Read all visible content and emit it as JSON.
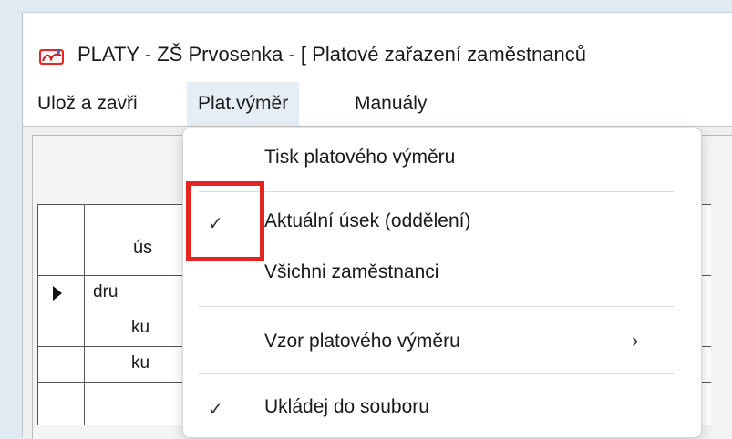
{
  "window": {
    "title": "PLATY  - ZŠ Prvosenka - [ Platové zařazení zaměstnanců",
    "icon": "rest-app-icon"
  },
  "menubar": {
    "items": [
      {
        "label": "Ulož a zavři"
      },
      {
        "label": "Plat.výměr"
      },
      {
        "label": "Manuály"
      }
    ]
  },
  "grid": {
    "header": "ús",
    "rows": [
      {
        "value": "dru",
        "current": true
      },
      {
        "value": "ku",
        "current": false
      },
      {
        "value": "ku",
        "current": false
      }
    ]
  },
  "dropdown": {
    "items": [
      {
        "label": "Tisk platového výměru",
        "checked": false,
        "submenu": false
      },
      {
        "label": "Aktuální úsek (oddělení)",
        "checked": true,
        "submenu": false
      },
      {
        "label": "Všichni zaměstnanci",
        "checked": false,
        "submenu": false
      },
      {
        "label": "Vzor platového výměru",
        "checked": false,
        "submenu": true
      },
      {
        "label": "Ukládej do souboru",
        "checked": true,
        "submenu": false
      }
    ],
    "check_glyph": "✓",
    "submenu_glyph": "›"
  },
  "colors": {
    "highlight": "#e5231f",
    "open_menu_bg": "#e6eef5"
  }
}
